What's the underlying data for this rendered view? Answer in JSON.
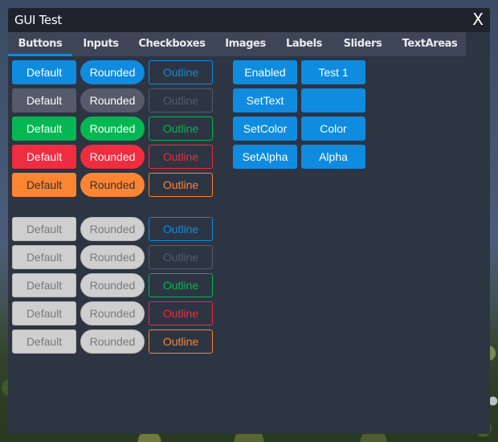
{
  "window": {
    "title": "GUI Test",
    "close_label": "X"
  },
  "tabs": [
    {
      "label": "Buttons",
      "active": true
    },
    {
      "label": "Inputs"
    },
    {
      "label": "Checkboxes"
    },
    {
      "label": "Images"
    },
    {
      "label": "Labels"
    },
    {
      "label": "Sliders"
    },
    {
      "label": "TextAreas"
    }
  ],
  "colors": {
    "accent": "#0f8be0",
    "secondary": "#555b6b",
    "success": "#04b752",
    "danger": "#f02c40",
    "warning": "#fb8533",
    "disabled": "#cfcfcf",
    "window_bg": "#2d3442",
    "titlebar_bg": "#1e232c",
    "tabbar_bg": "#3e4556"
  },
  "enabled_grid": {
    "rows": [
      {
        "style": "blue",
        "default": "Default",
        "rounded": "Rounded",
        "outline": "Outline"
      },
      {
        "style": "gray",
        "default": "Default",
        "rounded": "Rounded",
        "outline": "Outline"
      },
      {
        "style": "green",
        "default": "Default",
        "rounded": "Rounded",
        "outline": "Outline"
      },
      {
        "style": "red",
        "default": "Default",
        "rounded": "Rounded",
        "outline": "Outline"
      },
      {
        "style": "orange",
        "default": "Default",
        "rounded": "Rounded",
        "outline": "Outline"
      }
    ]
  },
  "disabled_grid": {
    "rows": [
      {
        "style": "blue",
        "default": "Default",
        "rounded": "Rounded",
        "outline": "Outline"
      },
      {
        "style": "gray",
        "default": "Default",
        "rounded": "Rounded",
        "outline": "Outline"
      },
      {
        "style": "green",
        "default": "Default",
        "rounded": "Rounded",
        "outline": "Outline"
      },
      {
        "style": "red",
        "default": "Default",
        "rounded": "Rounded",
        "outline": "Outline"
      },
      {
        "style": "orange",
        "default": "Default",
        "rounded": "Rounded",
        "outline": "Outline"
      }
    ]
  },
  "actions": {
    "enabled": "Enabled",
    "test1": "Test 1",
    "set_text": "SetText",
    "set_text_target": "",
    "set_color": "SetColor",
    "color": "Color",
    "set_alpha": "SetAlpha",
    "alpha": "Alpha"
  }
}
